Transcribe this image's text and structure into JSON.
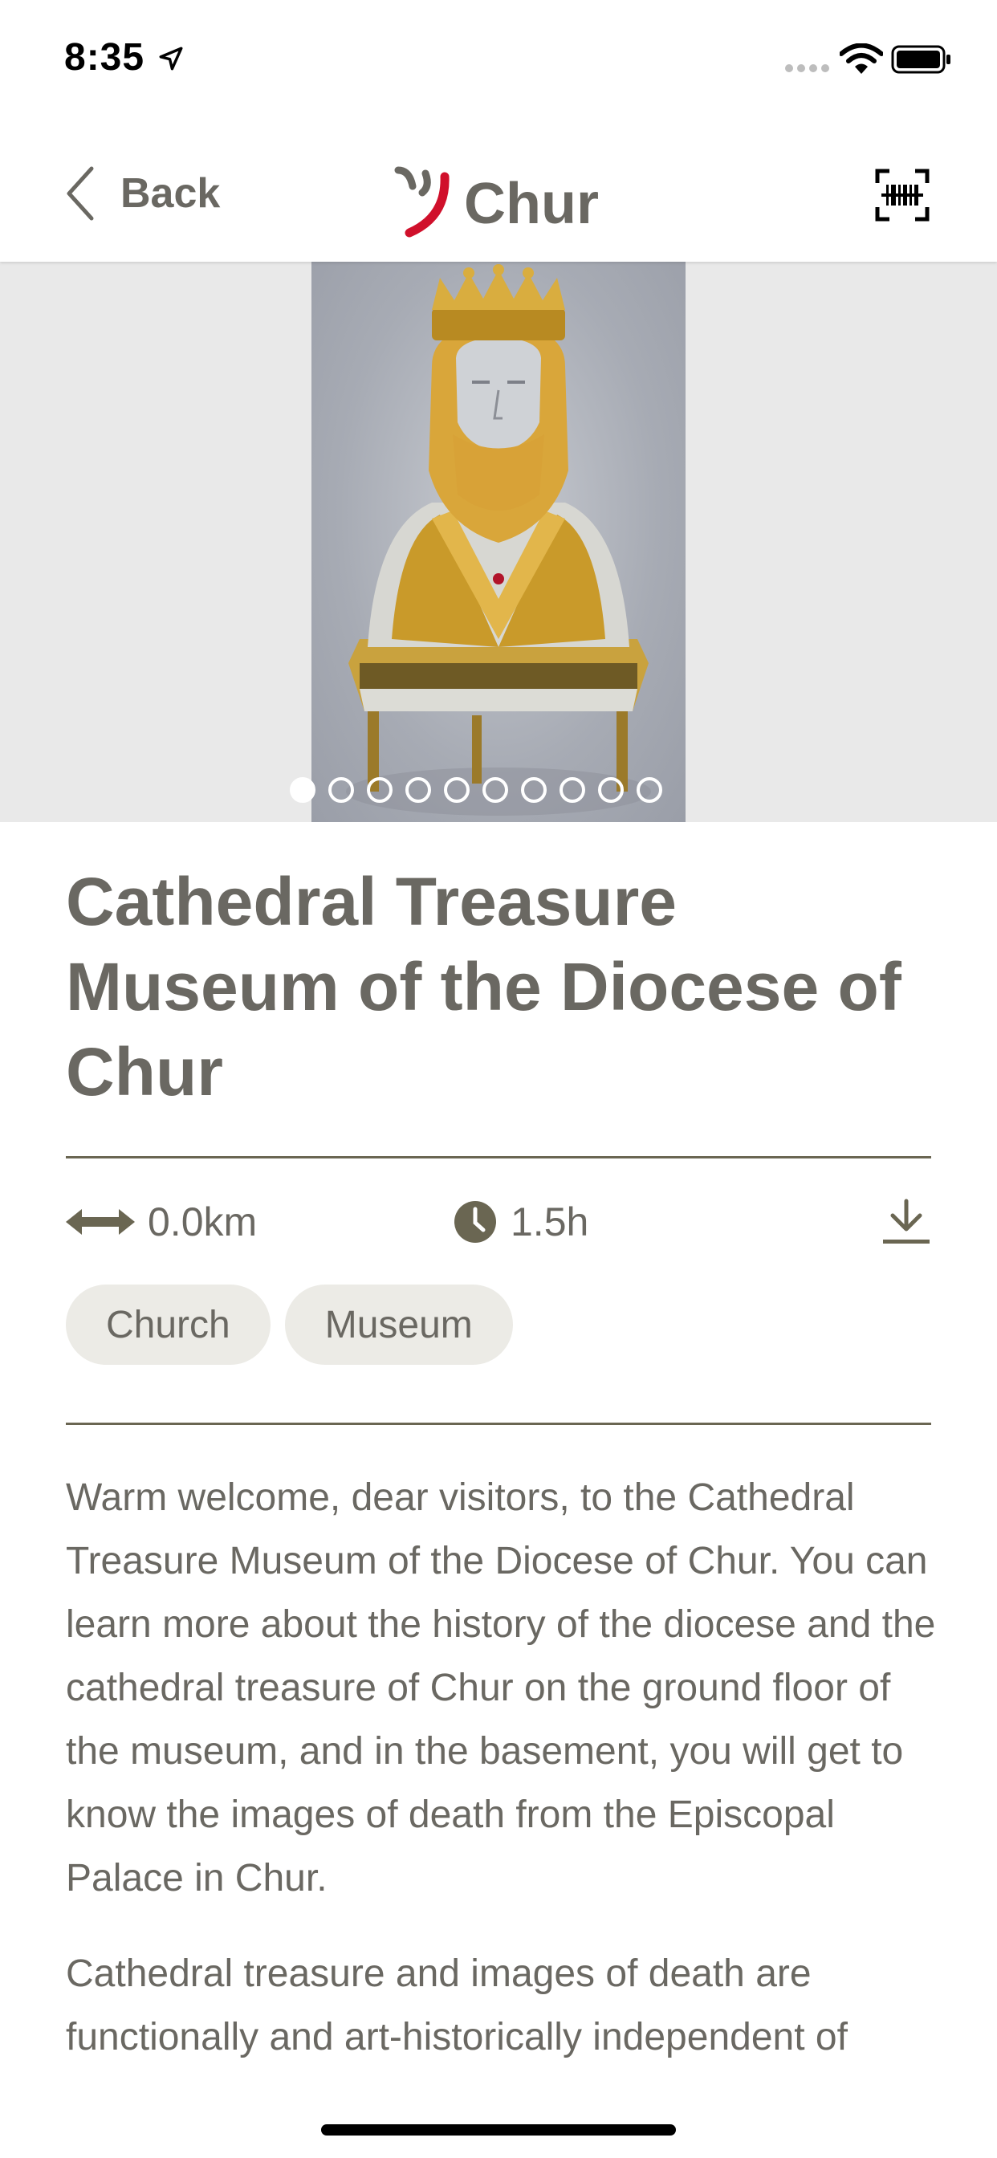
{
  "status_bar": {
    "time": "8:35"
  },
  "nav": {
    "back_label": "Back",
    "logo_text": "Chur"
  },
  "hero": {
    "image_count": 10,
    "active_index": 0
  },
  "place": {
    "title": "Cathedral Treasure Museum of the Diocese of Chur",
    "distance": "0.0km",
    "duration": "1.5h",
    "tags": [
      "Church",
      "Museum"
    ]
  },
  "description": {
    "paragraph_1": "Warm welcome, dear visitors, to the Cathedral Treasure Museum of the Diocese of Chur. You can learn more about the history of the diocese and the cathedral treasure of Chur on the ground floor of the museum, and in the basement, you will get to know the images of death from the Episcopal Palace in Chur.",
    "paragraph_2": "Cathedral treasure and images of death are functionally and art-historically independent of"
  },
  "colors": {
    "text": "#6a6862",
    "brand_red": "#d0102b",
    "tag_bg": "#ecebe6"
  }
}
